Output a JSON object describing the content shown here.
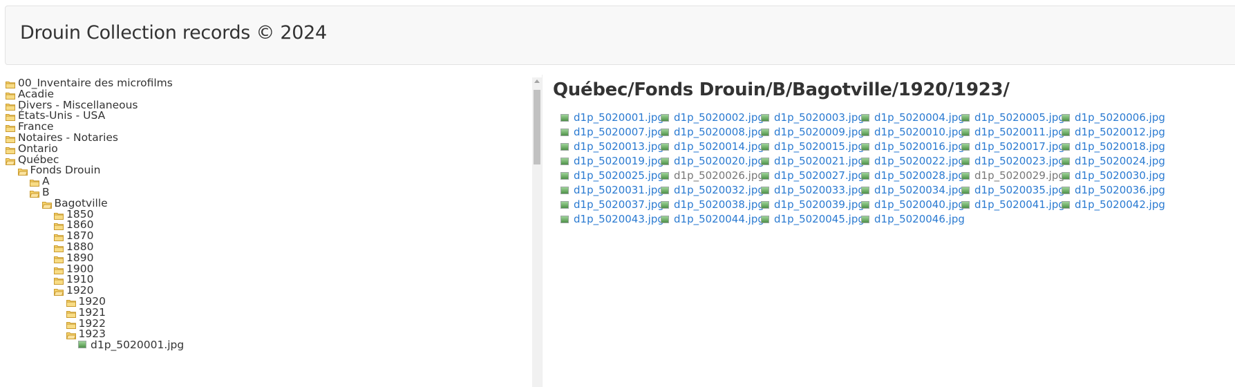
{
  "header": {
    "title": "Drouin Collection records © 2024"
  },
  "tree": [
    {
      "label": "00_Inventaire des microfilms",
      "depth": 0,
      "kind": "folder-closed",
      "icon": "folder-icon"
    },
    {
      "label": "Acadie",
      "depth": 0,
      "kind": "folder-closed",
      "icon": "folder-icon"
    },
    {
      "label": "Divers - Miscellaneous",
      "depth": 0,
      "kind": "folder-closed",
      "icon": "folder-icon"
    },
    {
      "label": "États-Unis - USA",
      "depth": 0,
      "kind": "folder-closed",
      "icon": "folder-icon"
    },
    {
      "label": "France",
      "depth": 0,
      "kind": "folder-closed",
      "icon": "folder-icon"
    },
    {
      "label": "Notaires - Notaries",
      "depth": 0,
      "kind": "folder-closed",
      "icon": "folder-icon"
    },
    {
      "label": "Ontario",
      "depth": 0,
      "kind": "folder-closed",
      "icon": "folder-icon"
    },
    {
      "label": "Québec",
      "depth": 0,
      "kind": "folder-open",
      "icon": "folder-open-icon"
    },
    {
      "label": "Fonds Drouin",
      "depth": 1,
      "kind": "folder-open",
      "icon": "folder-open-icon"
    },
    {
      "label": "A",
      "depth": 2,
      "kind": "folder-closed",
      "icon": "folder-icon"
    },
    {
      "label": "B",
      "depth": 2,
      "kind": "folder-open",
      "icon": "folder-open-icon"
    },
    {
      "label": "Bagotville",
      "depth": 3,
      "kind": "folder-open",
      "icon": "folder-open-icon"
    },
    {
      "label": "1850",
      "depth": 4,
      "kind": "folder-closed",
      "icon": "folder-icon"
    },
    {
      "label": "1860",
      "depth": 4,
      "kind": "folder-closed",
      "icon": "folder-icon"
    },
    {
      "label": "1870",
      "depth": 4,
      "kind": "folder-closed",
      "icon": "folder-icon"
    },
    {
      "label": "1880",
      "depth": 4,
      "kind": "folder-closed",
      "icon": "folder-icon"
    },
    {
      "label": "1890",
      "depth": 4,
      "kind": "folder-closed",
      "icon": "folder-icon"
    },
    {
      "label": "1900",
      "depth": 4,
      "kind": "folder-closed",
      "icon": "folder-icon"
    },
    {
      "label": "1910",
      "depth": 4,
      "kind": "folder-closed",
      "icon": "folder-icon"
    },
    {
      "label": "1920",
      "depth": 4,
      "kind": "folder-open",
      "icon": "folder-open-icon"
    },
    {
      "label": "1920",
      "depth": 5,
      "kind": "folder-closed",
      "icon": "folder-icon"
    },
    {
      "label": "1921",
      "depth": 5,
      "kind": "folder-closed",
      "icon": "folder-icon"
    },
    {
      "label": "1922",
      "depth": 5,
      "kind": "folder-closed",
      "icon": "folder-icon"
    },
    {
      "label": "1923",
      "depth": 5,
      "kind": "folder-open",
      "icon": "folder-open-icon"
    },
    {
      "label": "d1p_5020001.jpg",
      "depth": 6,
      "kind": "image",
      "icon": "image-file-icon"
    }
  ],
  "main": {
    "path_title": "Québec/Fonds Drouin/B/Bagotville/1920/1923/",
    "files": [
      {
        "name": "d1p_5020001.jpg",
        "visited": false
      },
      {
        "name": "d1p_5020002.jpg",
        "visited": false
      },
      {
        "name": "d1p_5020003.jpg",
        "visited": false
      },
      {
        "name": "d1p_5020004.jpg",
        "visited": false
      },
      {
        "name": "d1p_5020005.jpg",
        "visited": false
      },
      {
        "name": "d1p_5020006.jpg",
        "visited": false
      },
      {
        "name": "d1p_5020007.jpg",
        "visited": false
      },
      {
        "name": "d1p_5020008.jpg",
        "visited": false
      },
      {
        "name": "d1p_5020009.jpg",
        "visited": false
      },
      {
        "name": "d1p_5020010.jpg",
        "visited": false
      },
      {
        "name": "d1p_5020011.jpg",
        "visited": false
      },
      {
        "name": "d1p_5020012.jpg",
        "visited": false
      },
      {
        "name": "d1p_5020013.jpg",
        "visited": false
      },
      {
        "name": "d1p_5020014.jpg",
        "visited": false
      },
      {
        "name": "d1p_5020015.jpg",
        "visited": false
      },
      {
        "name": "d1p_5020016.jpg",
        "visited": false
      },
      {
        "name": "d1p_5020017.jpg",
        "visited": false
      },
      {
        "name": "d1p_5020018.jpg",
        "visited": false
      },
      {
        "name": "d1p_5020019.jpg",
        "visited": false
      },
      {
        "name": "d1p_5020020.jpg",
        "visited": false
      },
      {
        "name": "d1p_5020021.jpg",
        "visited": false
      },
      {
        "name": "d1p_5020022.jpg",
        "visited": false
      },
      {
        "name": "d1p_5020023.jpg",
        "visited": false
      },
      {
        "name": "d1p_5020024.jpg",
        "visited": false
      },
      {
        "name": "d1p_5020025.jpg",
        "visited": false
      },
      {
        "name": "d1p_5020026.jpg",
        "visited": true
      },
      {
        "name": "d1p_5020027.jpg",
        "visited": false
      },
      {
        "name": "d1p_5020028.jpg",
        "visited": false
      },
      {
        "name": "d1p_5020029.jpg",
        "visited": true
      },
      {
        "name": "d1p_5020030.jpg",
        "visited": false
      },
      {
        "name": "d1p_5020031.jpg",
        "visited": false
      },
      {
        "name": "d1p_5020032.jpg",
        "visited": false
      },
      {
        "name": "d1p_5020033.jpg",
        "visited": false
      },
      {
        "name": "d1p_5020034.jpg",
        "visited": false
      },
      {
        "name": "d1p_5020035.jpg",
        "visited": false
      },
      {
        "name": "d1p_5020036.jpg",
        "visited": false
      },
      {
        "name": "d1p_5020037.jpg",
        "visited": false
      },
      {
        "name": "d1p_5020038.jpg",
        "visited": false
      },
      {
        "name": "d1p_5020039.jpg",
        "visited": false
      },
      {
        "name": "d1p_5020040.jpg",
        "visited": false
      },
      {
        "name": "d1p_5020041.jpg",
        "visited": false
      },
      {
        "name": "d1p_5020042.jpg",
        "visited": false
      },
      {
        "name": "d1p_5020043.jpg",
        "visited": false
      },
      {
        "name": "d1p_5020044.jpg",
        "visited": false
      },
      {
        "name": "d1p_5020045.jpg",
        "visited": false
      },
      {
        "name": "d1p_5020046.jpg",
        "visited": false
      }
    ]
  },
  "colors": {
    "link": "#2a7ad1",
    "visited_link": "#777777",
    "folder": "#f0c14b",
    "header_bg": "#f8f8f8"
  }
}
